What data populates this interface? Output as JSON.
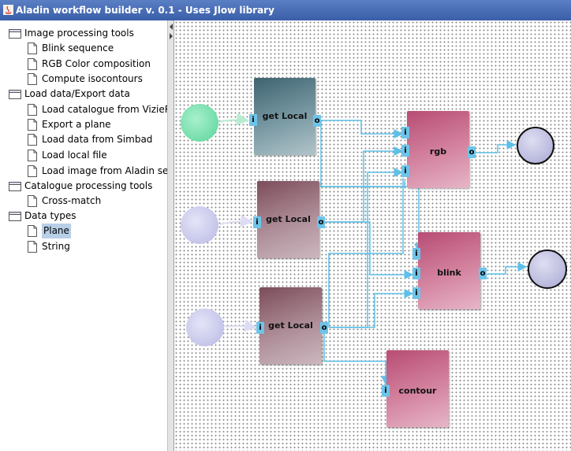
{
  "window": {
    "title": "Aladin workflow builder v. 0.1 - Uses Jlow library"
  },
  "tree": {
    "groups": [
      {
        "label": "Image processing tools",
        "items": [
          "Blink sequence",
          "RGB Color composition",
          "Compute isocontours"
        ]
      },
      {
        "label": "Load data/Export data",
        "items": [
          "Load catalogue from VizieR",
          "Export a plane",
          "Load data from Simbad",
          "Load local file",
          "Load image from Aladin serv"
        ]
      },
      {
        "label": "Catalogue processing tools",
        "items": [
          "Cross-match"
        ]
      },
      {
        "label": "Data types",
        "items": [
          "Plane",
          "String"
        ]
      }
    ],
    "selected_item": "Plane"
  },
  "canvas": {
    "nodes": {
      "get_local_1": {
        "label": "get Local",
        "input_port": "i",
        "output_port": "o"
      },
      "get_local_2": {
        "label": "get Local",
        "input_port": "i",
        "output_port": "o"
      },
      "get_local_3": {
        "label": "get Local",
        "input_port": "i",
        "output_port": "o"
      },
      "rgb": {
        "label": "rgb",
        "input_ports": [
          "i",
          "i",
          "i"
        ],
        "output_port": "o"
      },
      "blink": {
        "label": "blink",
        "input_ports": [
          "i",
          "i",
          "i"
        ],
        "output_port": "o"
      },
      "contour": {
        "label": "contour",
        "input_port": "i"
      }
    },
    "colors": {
      "connector": "#5ec0e8",
      "port": "#6ec4e8",
      "source_green": "#7fe0b0",
      "source_lavender": "#c8c8ec",
      "sink": "#c6c6e6"
    }
  }
}
